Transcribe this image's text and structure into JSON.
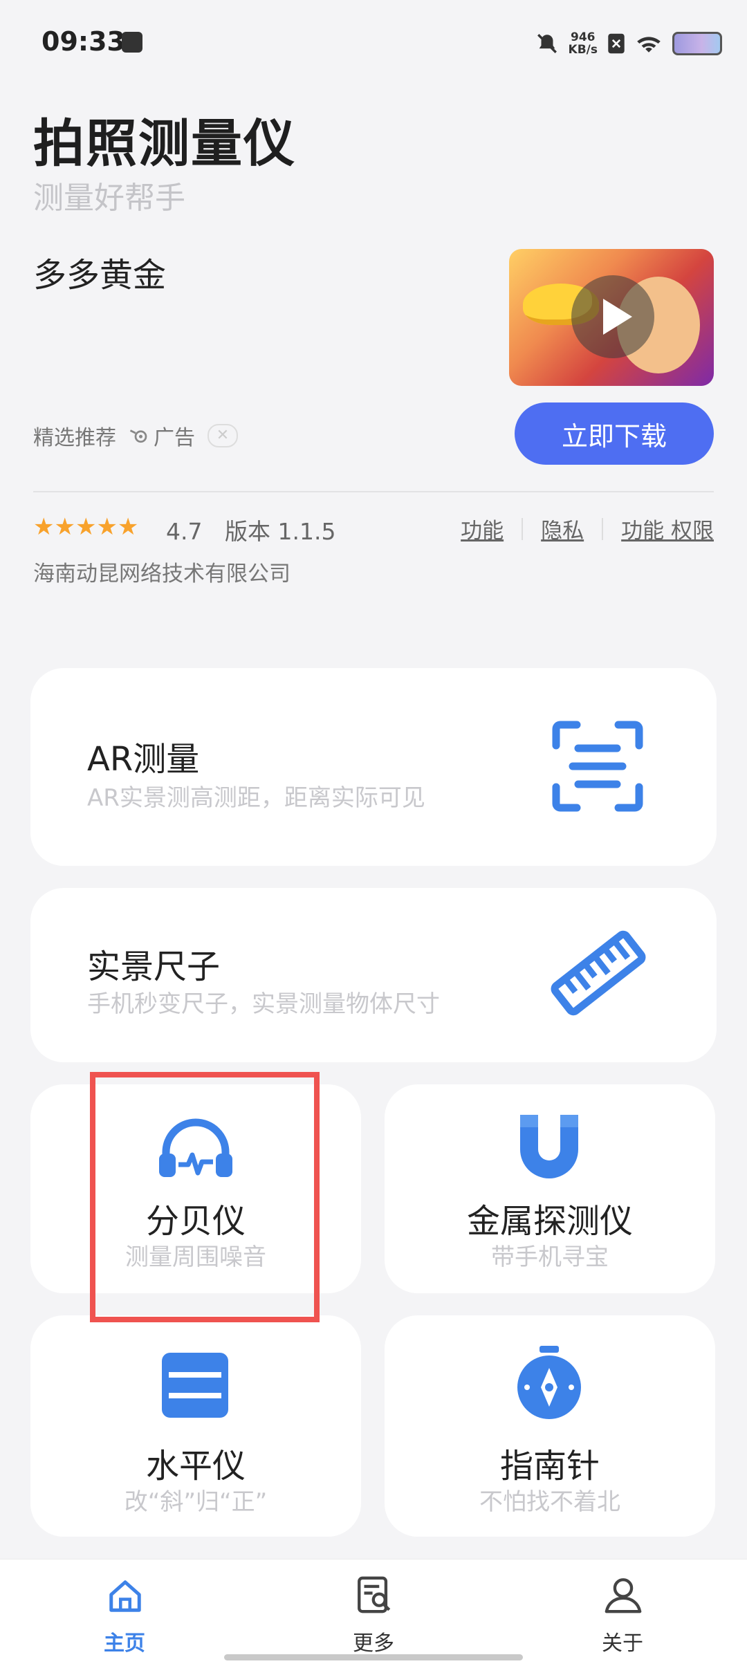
{
  "status_bar": {
    "time": "09:33",
    "net_speed_value": "946",
    "net_speed_unit": "KB/s"
  },
  "header": {
    "title": "拍照测量仪",
    "subtitle": "测量好帮手"
  },
  "ad": {
    "title": "多多黄金",
    "tag": "精选推荐",
    "ad_label": "广告",
    "close_symbol": "✕",
    "download_label": "立即下载"
  },
  "app_info": {
    "stars": "★★★★★",
    "rating": "4.7",
    "version": "版本 1.1.5",
    "link_feature": "功能",
    "link_privacy": "隐私",
    "link_permissions": "功能 权限",
    "company": "海南动昆网络技术有限公司"
  },
  "tools": {
    "ar": {
      "title": "AR测量",
      "subtitle": "AR实景测高测距，距离实际可见",
      "icon": "scan-icon"
    },
    "ruler": {
      "title": "实景尺子",
      "subtitle": "手机秒变尺子，实景测量物体尺寸",
      "icon": "ruler-icon"
    },
    "decibel": {
      "title": "分贝仪",
      "subtitle": "测量周围噪音",
      "icon": "headphones-wave-icon"
    },
    "metal": {
      "title": "金属探测仪",
      "subtitle": "带手机寻宝",
      "icon": "magnet-icon"
    },
    "level": {
      "title": "水平仪",
      "subtitle": "改“斜”归“正”",
      "icon": "level-icon"
    },
    "compass": {
      "title": "指南针",
      "subtitle": "不怕找不着北",
      "icon": "compass-icon"
    }
  },
  "bottom_nav": {
    "home": "主页",
    "more": "更多",
    "about": "关于"
  },
  "colors": {
    "accent": "#4e6ef2",
    "icon_blue": "#3d82e8",
    "highlight_red": "#ef5350",
    "star": "#f8a22c"
  }
}
